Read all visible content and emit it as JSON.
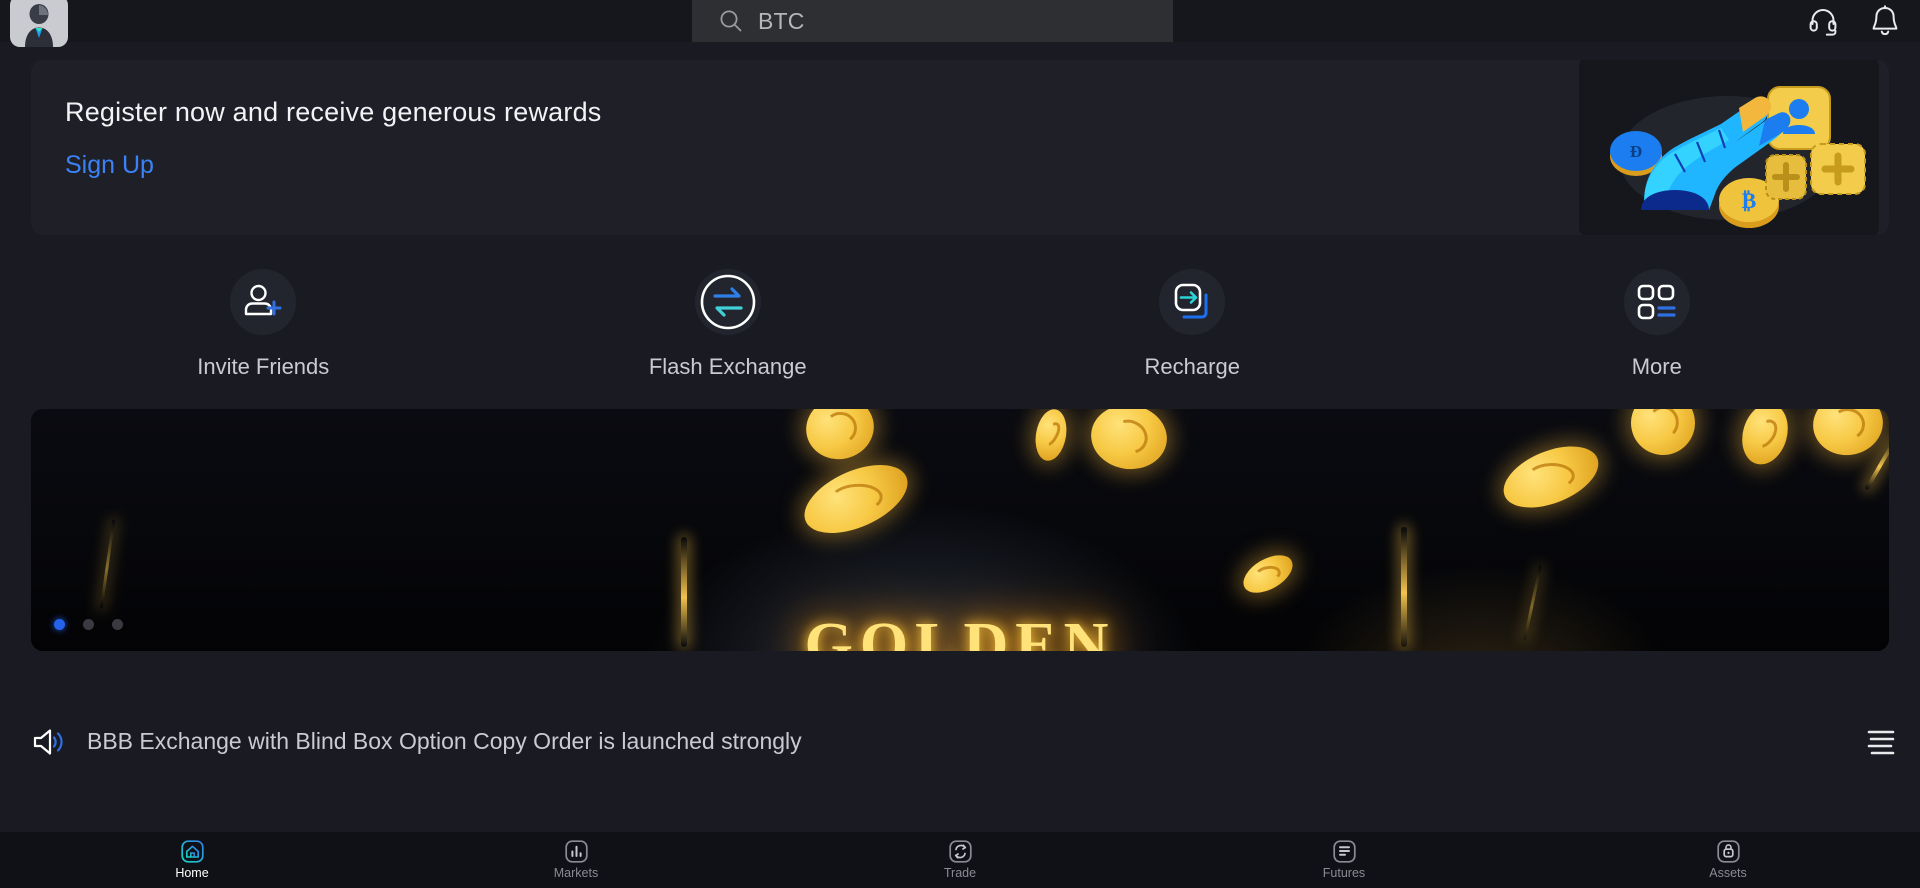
{
  "app": {
    "name": "BBB Exchange",
    "background_color": "#1a1b22",
    "accent_color": "#3b82f6",
    "accent_cyan": "#2dd4d4"
  },
  "topbar": {
    "avatar_label": "Profile avatar",
    "avatar_icon": "user-avatar-icon",
    "search": {
      "icon": "search-icon",
      "value": "BTC",
      "placeholder": "BTC"
    },
    "icons": [
      {
        "name": "headset-support-icon",
        "label": "Customer Support"
      },
      {
        "name": "bell-notification-icon",
        "label": "Notifications"
      }
    ]
  },
  "promo": {
    "title": "Register now and receive generous rewards",
    "link_label": "Sign Up",
    "link_color": "#3b82f6",
    "illustration": "robot-hand-pointing-at-cards-illustration"
  },
  "quick_actions": [
    {
      "label": "Invite Friends",
      "icon": "user-plus-icon"
    },
    {
      "label": "Flash Exchange",
      "icon": "swap-arrows-circle-icon"
    },
    {
      "label": "Recharge",
      "icon": "arrow-into-box-icon"
    },
    {
      "label": "More",
      "icon": "grid-more-icon"
    }
  ],
  "carousel": {
    "glow_text": "GOLDEN",
    "slide_count": 3,
    "active_slide": 1,
    "theme": "falling-gold-coins"
  },
  "announcement": {
    "icon": "megaphone-icon",
    "text": "BBB Exchange with Blind Box Option Copy Order is launched strongly",
    "menu_icon": "list-menu-icon"
  },
  "bottom_nav": {
    "active_index": 0,
    "items": [
      {
        "label": "Home",
        "icon": "home-icon"
      },
      {
        "label": "Markets",
        "icon": "bar-chart-icon"
      },
      {
        "label": "Trade",
        "icon": "swap-circle-icon"
      },
      {
        "label": "Futures",
        "icon": "list-lines-icon"
      },
      {
        "label": "Assets",
        "icon": "wallet-icon"
      }
    ]
  }
}
